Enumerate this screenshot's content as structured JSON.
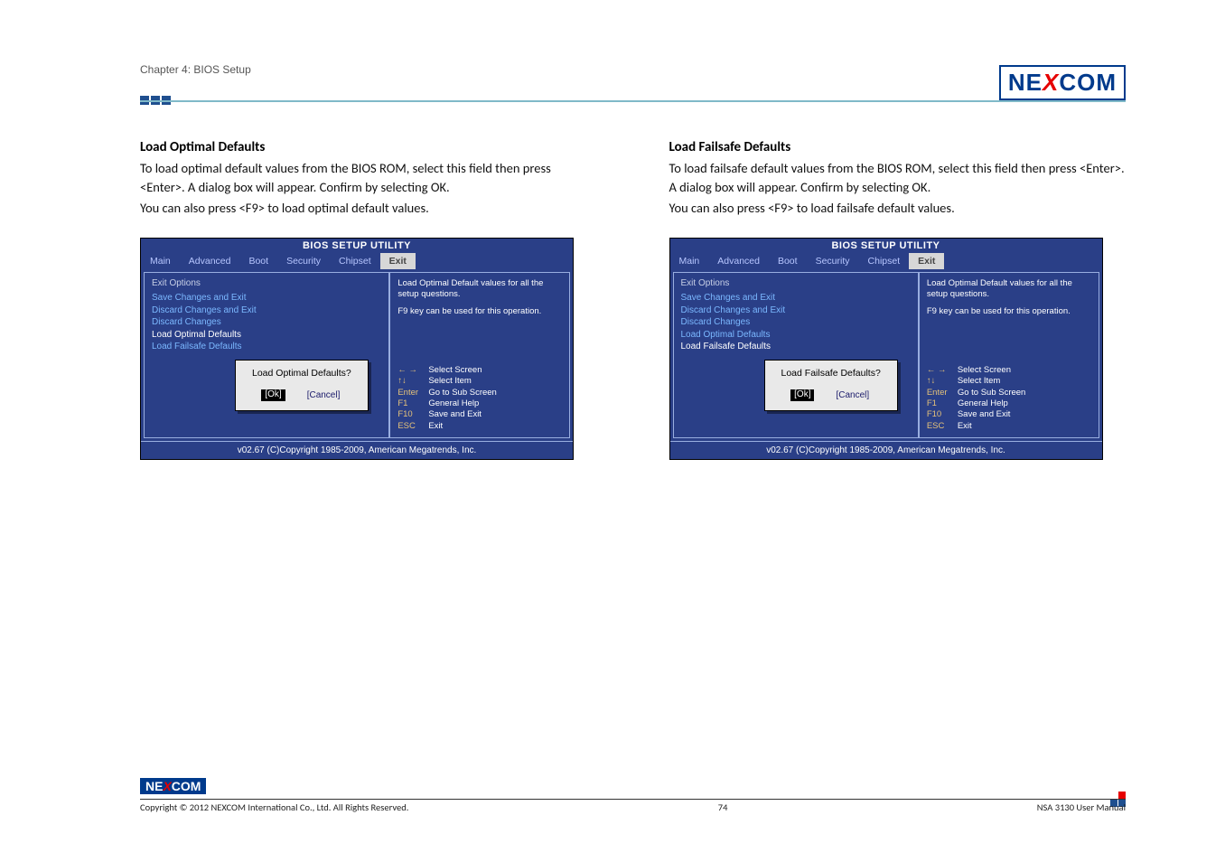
{
  "header": {
    "chapter": "Chapter 4: BIOS Setup",
    "logo_brand": "NE",
    "logo_x": "X",
    "logo_end": "COM"
  },
  "left": {
    "title": "Load Optimal Defaults",
    "p1": "To load optimal default values from the BIOS ROM, select this field then press <Enter>. A dialog box will appear. Confirm by selecting OK.",
    "p2": "You can also press <F9> to load optimal default values."
  },
  "right": {
    "title": "Load Failsafe Defaults",
    "p1": "To load failsafe default values from the BIOS ROM, select this field then press <Enter>. A dialog box will appear. Confirm by selecting OK.",
    "p2": "You can also press <F9> to load failsafe default values."
  },
  "bios": {
    "title": "BIOS SETUP UTILITY",
    "tabs": [
      "Main",
      "Advanced",
      "Boot",
      "Security",
      "Chipset",
      "Exit"
    ],
    "group": "Exit Options",
    "items": [
      "Save Changes and Exit",
      "Discard Changes and Exit",
      "Discard Changes",
      "Load Optimal Defaults",
      "Load Failsafe Defaults"
    ],
    "help": "Load Optimal Default values for all the setup questions.",
    "help2": "F9 key can be used for this operation.",
    "keys": [
      {
        "k": "← →",
        "d": "Select Screen"
      },
      {
        "k": "↑↓",
        "d": "Select Item"
      },
      {
        "k": "Enter",
        "d": "Go to Sub Screen"
      },
      {
        "k": "F1",
        "d": "General Help"
      },
      {
        "k": "F10",
        "d": "Save and Exit"
      },
      {
        "k": "ESC",
        "d": "Exit"
      }
    ],
    "dialog_left": {
      "q": "Load Optimal Defaults?",
      "ok": "[Ok]",
      "cancel": "[Cancel]"
    },
    "dialog_right": {
      "q": "Load Failsafe Defaults?",
      "ok": "[Ok]",
      "cancel": "[Cancel]"
    },
    "footer": "v02.67 (C)Copyright 1985-2009, American Megatrends, Inc."
  },
  "footer": {
    "copyright": "Copyright © 2012 NEXCOM International Co., Ltd. All Rights Reserved.",
    "page": "74",
    "doc": "NSA 3130 User Manual"
  }
}
